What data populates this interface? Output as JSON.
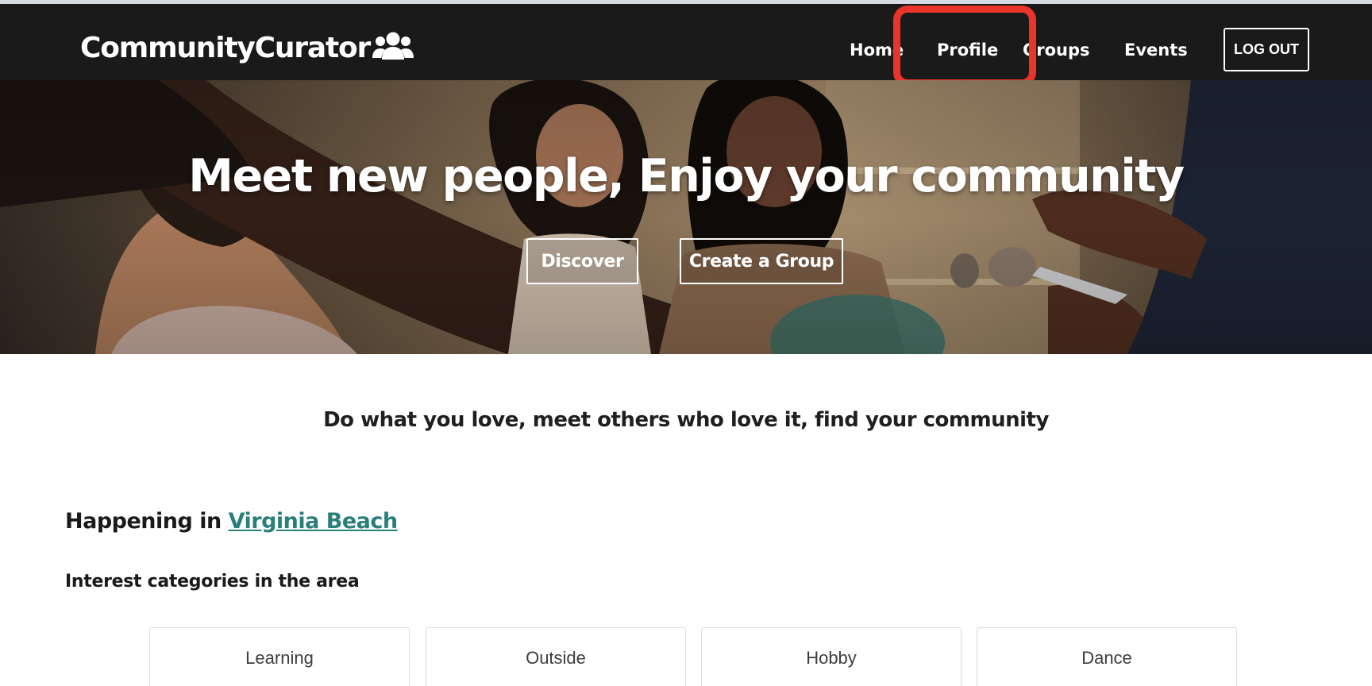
{
  "navbar": {
    "brand": "CommunityCurator",
    "brand_icon": "users-icon",
    "links": [
      "Home",
      "Profile",
      "Groups",
      "Events"
    ],
    "logout_label": "LOG OUT",
    "highlighted_item": "Profile",
    "highlight_color": "#e8342a",
    "background_color": "#1b1a1a"
  },
  "hero": {
    "title": "Meet new people, Enjoy your community",
    "discover_label": "Discover",
    "create_group_label": "Create a Group"
  },
  "tagline": "Do what you love, meet others who love it, find your community",
  "happening": {
    "prefix": "Happening in ",
    "location": "Virginia Beach",
    "link_color": "#2b7f7b"
  },
  "interests": {
    "heading": "Interest categories in the area",
    "categories": [
      "Learning",
      "Outside",
      "Hobby",
      "Dance"
    ]
  }
}
